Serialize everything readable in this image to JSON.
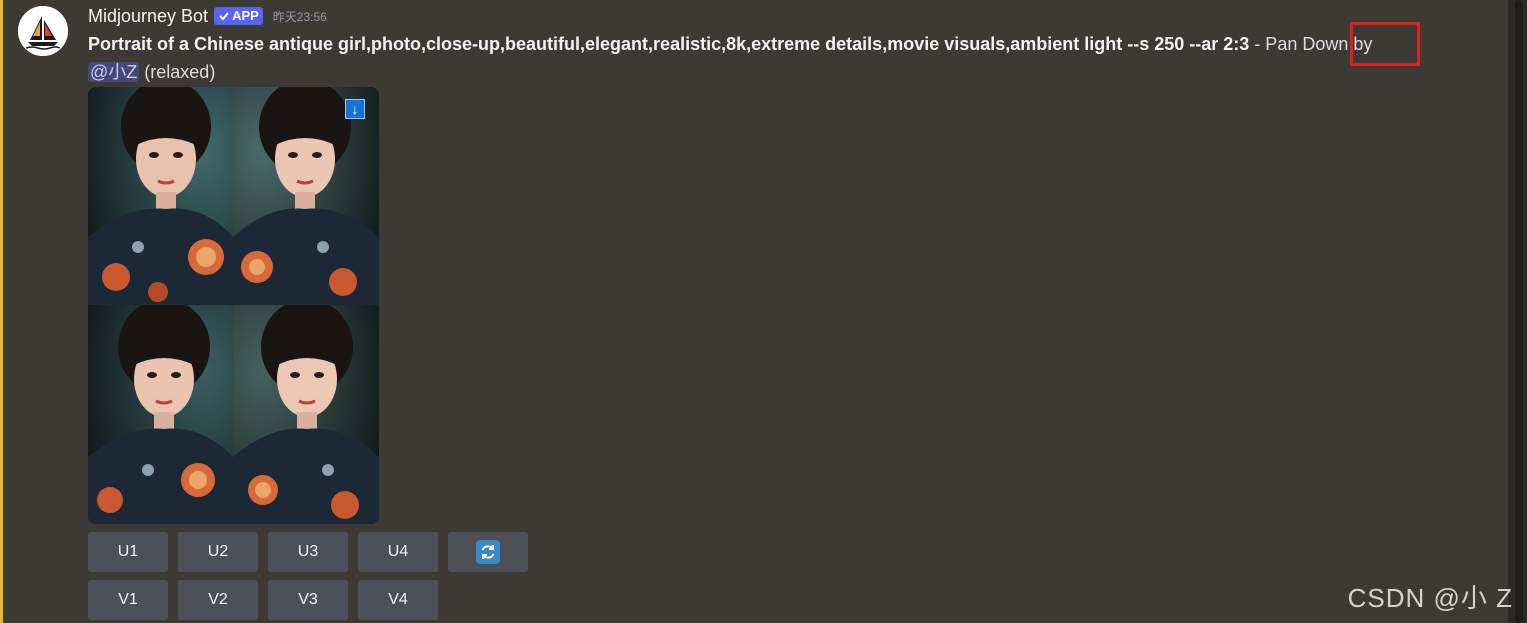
{
  "bot": {
    "name": "Midjourney Bot",
    "badge": "APP",
    "timestamp": "昨天23:56"
  },
  "message": {
    "prompt": "Portrait of a Chinese antique girl,photo,close-up,beautiful,elegant,realistic,8k,extreme details,movie visuals,ambient light --s 250 --ar 2:3",
    "action": " - Pan Down by ",
    "mention": "@小Z",
    "mode": " (relaxed)"
  },
  "image_grid": {
    "pan_indicator": "↓"
  },
  "buttons": {
    "upscale": [
      "U1",
      "U2",
      "U3",
      "U4"
    ],
    "variation": [
      "V1",
      "V2",
      "V3",
      "V4"
    ],
    "reroll_icon": "refresh-icon"
  },
  "watermark": "CSDN @小 Z",
  "colors": {
    "background": "#3d3a36",
    "button": "#4e5058",
    "badge": "#5865f2",
    "highlight": "#e0201a"
  }
}
